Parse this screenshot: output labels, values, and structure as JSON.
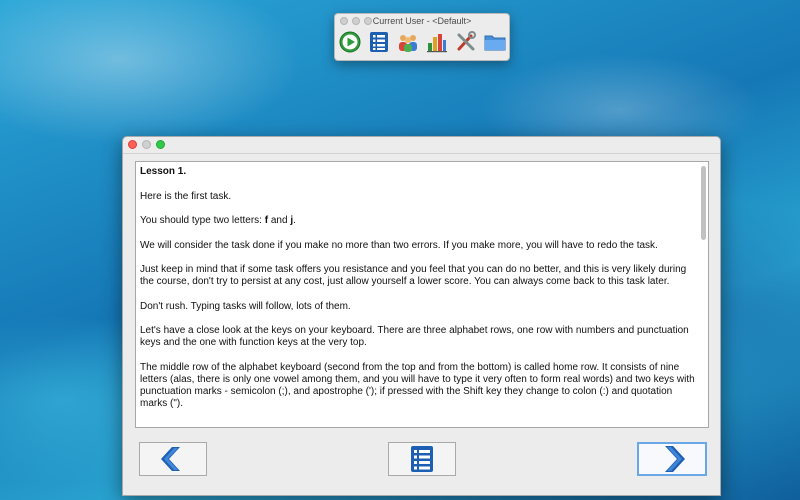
{
  "toolbar_window": {
    "title": "Current User - <Default>",
    "icons": [
      "play-icon",
      "list-icon",
      "users-icon",
      "statistics-icon",
      "settings-tools-icon",
      "folder-icon"
    ]
  },
  "lesson": {
    "title": "Lesson 1.",
    "p1": "Here is the first task.",
    "p2_pre": "You should type two letters: ",
    "p2_f": "f",
    "p2_mid": " and ",
    "p2_j": "j",
    "p2_post": ".",
    "p3": "We will consider the task done if you make no more than two errors. If you make more, you will have to redo the task.",
    "p4": "Just keep in mind that if some task offers you resistance and you feel that you can do no better, and this is very likely during the course, don't try to persist at any cost, just allow yourself a lower score. You can always come back to this task later.",
    "p5": "Don't rush. Typing tasks will follow, lots of them.",
    "p6": "Let's have a close look at the keys on your keyboard. There are three alphabet rows, one row with numbers and punctuation keys and the one with function keys at the very top.",
    "p7": "The middle row of the alphabet keyboard (second from the top and from the bottom) is called home row. It consists of nine letters (alas, there is only one vowel among them, and you will have to type it very often to form real words) and two keys with punctuation marks - semicolon (;), and apostrophe ('); if pressed with the Shift key they change to colon (:) and quotation marks (\")."
  },
  "nav": {
    "prev_icon": "chevron-left-icon",
    "list_icon": "list-icon",
    "next_icon": "chevron-right-icon"
  },
  "colors": {
    "chevron": "#1f5fb0",
    "list_blue": "#1d5fb3",
    "focus_ring": "#6aa7e8"
  }
}
